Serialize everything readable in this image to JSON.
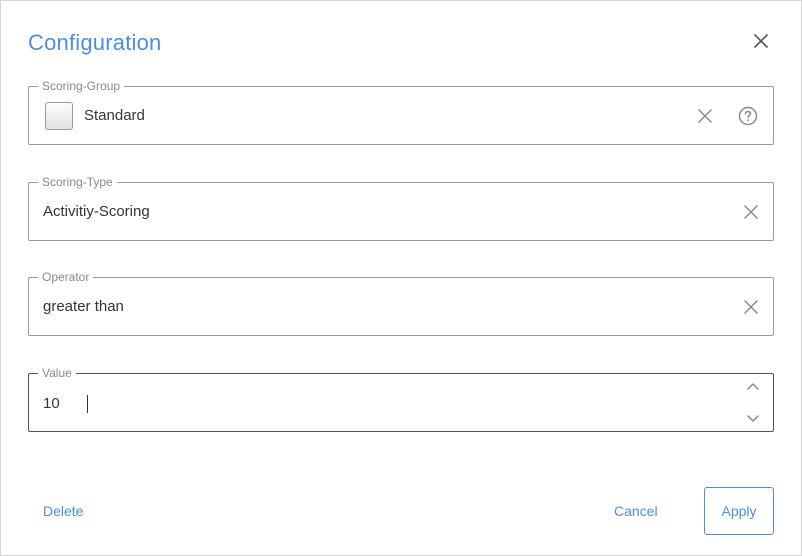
{
  "dialog": {
    "title": "Configuration"
  },
  "fields": {
    "scoring_group": {
      "label": "Scoring-Group",
      "value": "Standard"
    },
    "scoring_type": {
      "label": "Scoring-Type",
      "value": "Activitiy-Scoring"
    },
    "operator": {
      "label": "Operator",
      "value": "greater than"
    },
    "value": {
      "label": "Value",
      "value": "10"
    }
  },
  "footer": {
    "delete_label": "Delete",
    "cancel_label": "Cancel",
    "apply_label": "Apply"
  },
  "colors": {
    "accent": "#4a8fe7",
    "border": "#9a9a9a",
    "label": "#8a8a8a"
  },
  "icons": {
    "close": "close-icon",
    "clear": "clear-icon",
    "help": "help-icon",
    "spin_up": "chevron-up-icon",
    "spin_down": "chevron-down-icon"
  }
}
